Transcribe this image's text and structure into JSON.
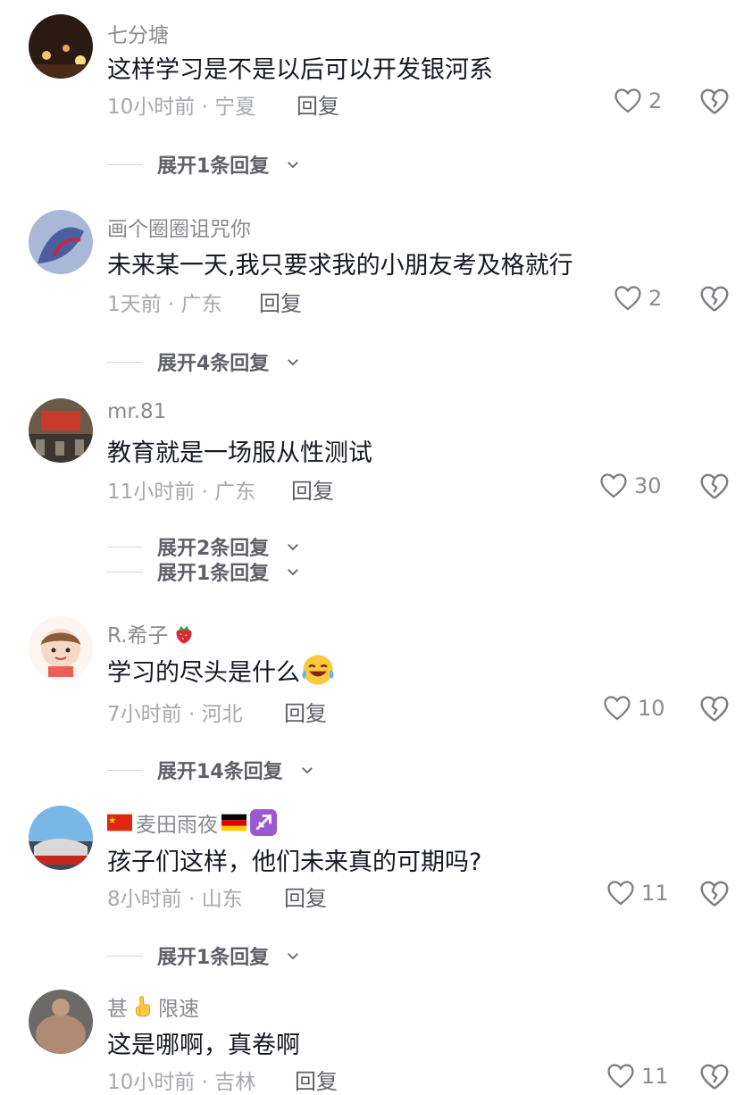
{
  "comments": [
    {
      "username": "七分塘",
      "text": "这样学习是不是以后可以开发银河系",
      "time_location": "10小时前 · 宁夏",
      "reply_label": "回复",
      "likes": "2",
      "expand": [
        "展开1条回复"
      ]
    },
    {
      "username": "画个圈圈诅咒你",
      "text": "未来某一天,我只要求我的小朋友考及格就行",
      "time_location": "1天前 · 广东",
      "reply_label": "回复",
      "likes": "2",
      "expand": [
        "展开4条回复"
      ]
    },
    {
      "username": "mr.81",
      "text": "教育就是一场服从性测试",
      "time_location": "11小时前 · 广东",
      "reply_label": "回复",
      "likes": "30",
      "expand": [
        "展开2条回复",
        "展开1条回复"
      ]
    },
    {
      "username": "R.希子",
      "text": "学习的尽头是什么",
      "time_location": "7小时前 · 河北",
      "reply_label": "回复",
      "likes": "10",
      "expand": [
        "展开14条回复"
      ]
    },
    {
      "username": "麦田雨夜",
      "text": "孩子们这样，他们未来真的可期吗?",
      "time_location": "8小时前 · 山东",
      "reply_label": "回复",
      "likes": "11",
      "expand": [
        "展开1条回复"
      ]
    },
    {
      "username_pre": "甚",
      "username_post": "限速",
      "text": "这是哪啊，真卷啊",
      "time_location": "10小时前 · 吉林",
      "reply_label": "回复",
      "likes": "11",
      "expand": []
    }
  ],
  "colors": {
    "text_primary": "#161823",
    "text_secondary": "#8a8b91",
    "text_meta": "#a7a8ad",
    "divider": "#d6d6d9"
  },
  "icons": {
    "like": "heart-outline-icon",
    "dislike": "broken-heart-icon",
    "expand": "chevron-down-icon"
  }
}
